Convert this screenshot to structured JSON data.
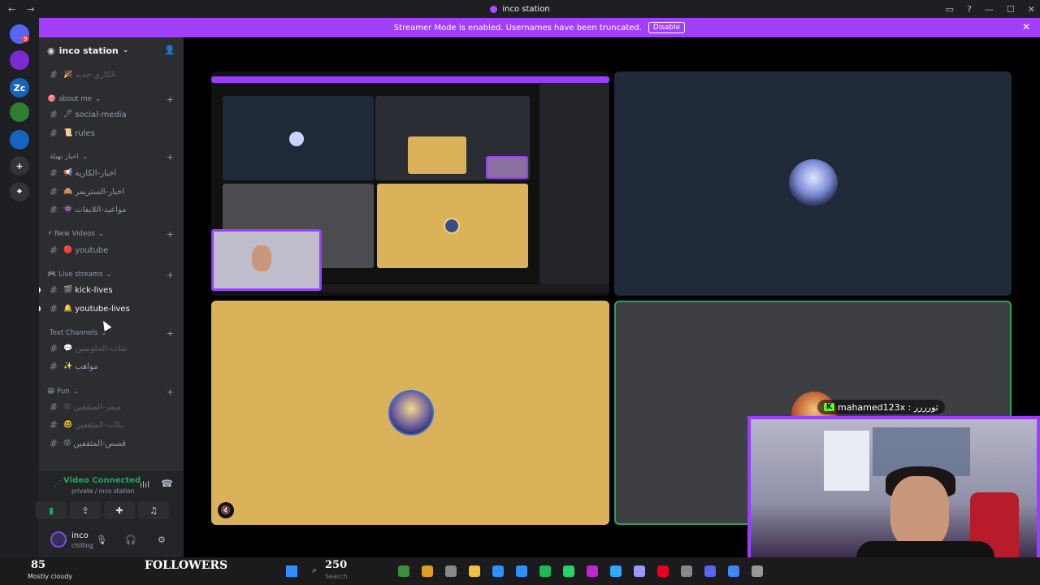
{
  "window": {
    "title": "inco station",
    "back": "←",
    "forward": "→",
    "minimize": "—",
    "maximize": "☐",
    "close": "✕",
    "inbox_icon": "inbox-icon",
    "help_icon": "help-icon"
  },
  "banner": {
    "text": "Streamer Mode is enabled. Usernames have been truncated.",
    "button": "Disable",
    "close": "✕"
  },
  "guilds": [
    {
      "label": "",
      "badge": "9",
      "color": "#5865f2"
    },
    {
      "label": "",
      "color": "#7b2bd0"
    },
    {
      "label": "Zc",
      "color": "#1565c0"
    },
    {
      "label": "",
      "color": "#2e7d32"
    },
    {
      "label": "",
      "color": "#1565c0"
    },
    {
      "label": "+",
      "color": "#313338"
    },
    {
      "label": "⌖",
      "color": "#313338"
    }
  ],
  "server": {
    "name": "inco station",
    "chevron": "⌄",
    "invite_icon": "add-member-icon"
  },
  "channel_list": [
    {
      "kind": "ch",
      "emoji": "🎉",
      "label": "الكاري-جديد",
      "style": "dim"
    },
    {
      "kind": "cat",
      "emoji": "🎯",
      "label": "about me"
    },
    {
      "kind": "ch",
      "emoji": "🖊",
      "label": "social-media",
      "style": "normal"
    },
    {
      "kind": "ch",
      "emoji": "📜",
      "label": "rules",
      "style": "normal"
    },
    {
      "kind": "cat",
      "emoji": "",
      "label": "اخبار نهيلة"
    },
    {
      "kind": "ch",
      "emoji": "📢",
      "label": "اخبار-الكارية",
      "style": "normal"
    },
    {
      "kind": "ch",
      "emoji": "🙈",
      "label": "اخبار-الستريمر",
      "style": "normal"
    },
    {
      "kind": "ch",
      "emoji": "👾",
      "label": "مواعيد-اللايفات",
      "style": "normal"
    },
    {
      "kind": "cat",
      "emoji": "⚡",
      "label": "New Videos"
    },
    {
      "kind": "ch",
      "emoji": "🔴",
      "label": "youtube",
      "style": "normal"
    },
    {
      "kind": "cat",
      "emoji": "🎮",
      "label": "Live streams"
    },
    {
      "kind": "ch",
      "emoji": "🎬",
      "label": "kick-lives",
      "style": "bright",
      "unread": true
    },
    {
      "kind": "ch",
      "emoji": "🔔",
      "label": "youtube-lives",
      "style": "bright",
      "unread": true
    },
    {
      "kind": "cat",
      "emoji": "",
      "label": "Text Channels"
    },
    {
      "kind": "ch",
      "emoji": "💬",
      "label": "شات-الحلوسين",
      "style": "dim"
    },
    {
      "kind": "ch",
      "emoji": "✨",
      "label": "مواهب",
      "style": "normal"
    },
    {
      "kind": "cat",
      "emoji": "😁",
      "label": "Fun"
    },
    {
      "kind": "ch",
      "emoji": "😵",
      "label": "ميمز-المثقفين",
      "style": "dim"
    },
    {
      "kind": "ch",
      "emoji": "🤓",
      "label": "نكات-المثقفين",
      "style": "dim"
    },
    {
      "kind": "ch",
      "emoji": "😰",
      "label": "قصص-المثقفين",
      "style": "normal"
    }
  ],
  "voice": {
    "status": "Video Connected",
    "sub": "private / inco station",
    "noise_icon": "noise-suppression-icon",
    "disconnect_icon": "disconnect-icon",
    "buttons": [
      {
        "name": "camera-icon",
        "glyph": "▮"
      },
      {
        "name": "screen-share-icon",
        "glyph": "⇪"
      },
      {
        "name": "activity-icon",
        "glyph": "✚"
      },
      {
        "name": "soundboard-icon",
        "glyph": "♫"
      }
    ]
  },
  "user": {
    "name": "inco",
    "status": "chilling",
    "mic": "🎙",
    "headset": "🎧",
    "settings": "⚙"
  },
  "stage": {
    "overlay_name": "mahamed123x : ثورررر",
    "overlay_badge": "K",
    "mute_icon": "🔇"
  },
  "taskbar": {
    "temp": "85",
    "weather": "Mostly cloudy",
    "followers_label": "FOLLOWERS",
    "followers_count": "250",
    "search": "Search"
  }
}
